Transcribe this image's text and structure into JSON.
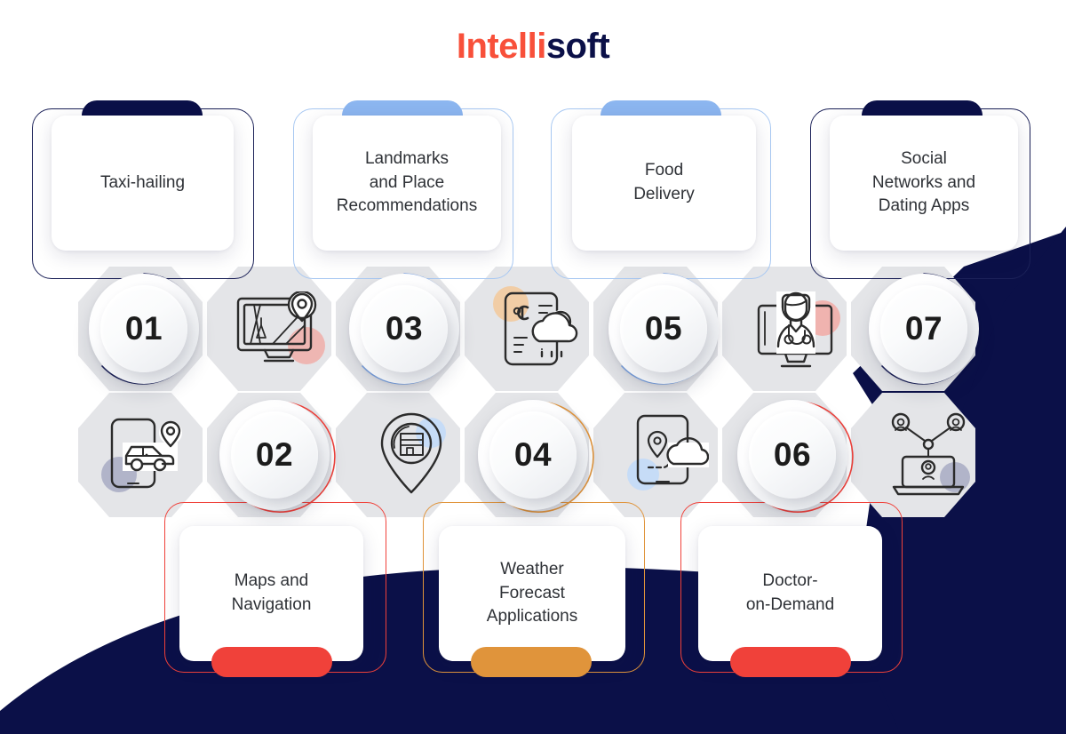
{
  "brand": {
    "part1": "Intelli",
    "part2": "soft",
    "color1": "#F8503A",
    "color2": "#0B1048"
  },
  "palette": {
    "navy": "#0B1048",
    "light_blue": "#8CB6F0",
    "red": "#F0413A",
    "orange": "#E0943B",
    "pink_blob": "#F2A6A0",
    "blue_blob": "#C6DCF7",
    "gray_blob": "#9BA0BC",
    "orange_blob": "#F3C99A",
    "hex_gray": "#E3E4E6"
  },
  "top_cards": [
    {
      "label": "Taxi-hailing",
      "pill_color": "#0B1048",
      "frame_color": "#0B1048"
    },
    {
      "label": "Landmarks\nand Place\nRecommendations",
      "pill_color": "#8CB6F0",
      "frame_color": "#A8C8F2"
    },
    {
      "label": "Food\nDelivery",
      "pill_color": "#8CB6F0",
      "frame_color": "#A8C8F2"
    },
    {
      "label": "Social\nNetworks and\nDating Apps",
      "pill_color": "#0B1048",
      "frame_color": "#0B1048"
    }
  ],
  "bottom_cards": [
    {
      "label": "Maps and\nNavigation",
      "pill_color": "#F0413A",
      "frame_color": "#F0413A"
    },
    {
      "label": "Weather\nForecast\nApplications",
      "pill_color": "#E0943B",
      "frame_color": "#E0943B"
    },
    {
      "label": "Doctor-\non-Demand",
      "pill_color": "#F0413A",
      "frame_color": "#F0413A"
    }
  ],
  "numbers": [
    {
      "value": "01",
      "arc_color": "#1B2158"
    },
    {
      "value": "02",
      "arc_color": "#F0413A"
    },
    {
      "value": "03",
      "arc_color": "#7FA9E8"
    },
    {
      "value": "04",
      "arc_color": "#E0943B"
    },
    {
      "value": "05",
      "arc_color": "#7FA9E8"
    },
    {
      "value": "06",
      "arc_color": "#F0413A"
    },
    {
      "value": "07",
      "arc_color": "#1B2158"
    }
  ],
  "icons": [
    {
      "name": "map-monitor-icon",
      "blob_color": "#F2A6A0"
    },
    {
      "name": "phone-car-location-icon",
      "blob_color": "#9BA0BC"
    },
    {
      "name": "location-pin-landmark-icon",
      "blob_color": "#C6DCF7"
    },
    {
      "name": "phone-weather-icon",
      "blob_color": "#F3C99A"
    },
    {
      "name": "phone-food-delivery-icon",
      "blob_color": "#C6DCF7"
    },
    {
      "name": "doctor-monitor-icon",
      "blob_color": "#F2A6A0"
    },
    {
      "name": "social-network-laptop-icon",
      "blob_color": "#9BA0BC"
    }
  ]
}
